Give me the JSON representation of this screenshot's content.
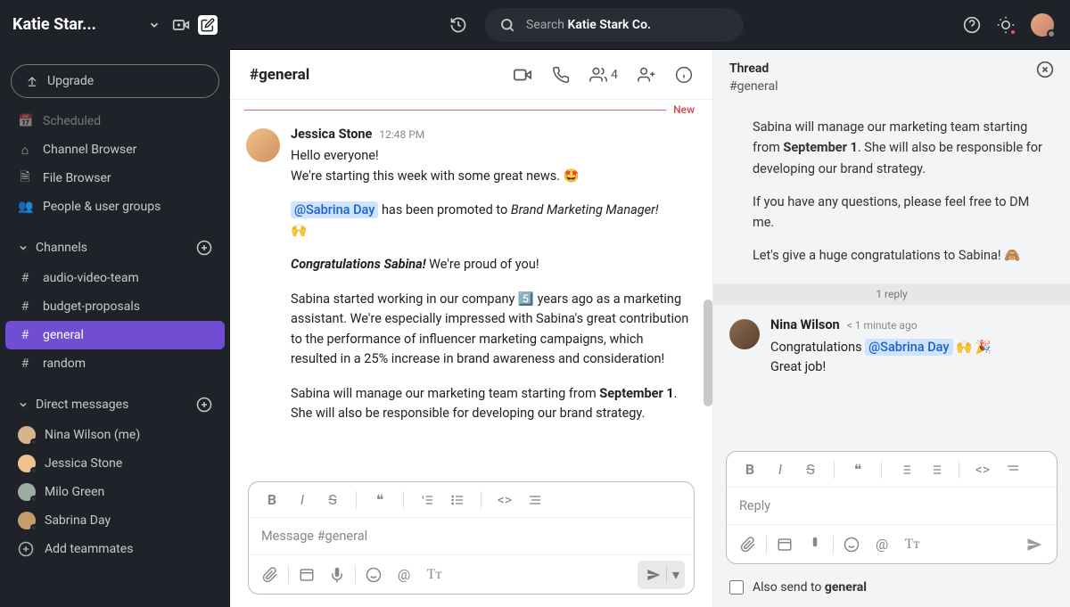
{
  "workspace": {
    "name": "Katie Star..."
  },
  "search": {
    "prefix": "Search",
    "scope": "Katie Stark Co."
  },
  "sidebar": {
    "upgrade": "Upgrade",
    "nav": [
      "Scheduled",
      "Channel Browser",
      "File Browser",
      "People & user groups"
    ],
    "channels_label": "Channels",
    "channels": [
      "audio-video-team",
      "budget-proposals",
      "general",
      "random"
    ],
    "dm_label": "Direct messages",
    "dms": [
      "Nina Wilson (me)",
      "Jessica Stone",
      "Milo Green",
      "Sabrina Day"
    ],
    "add_teammates": "Add teammates"
  },
  "channel": {
    "name": "#general",
    "member_count": "4",
    "new_label": "New",
    "composer_placeholder": "Message #general"
  },
  "message": {
    "author": "Jessica Stone",
    "time": "12:48 PM",
    "line1": "Hello everyone!",
    "line2": "We're starting this week with some great news. 🤩",
    "mention": "@Sabrina Day",
    "line3_after": " has been promoted to ",
    "role": "Brand Marketing Manager!",
    "hands": "🙌",
    "congrats": "Congratulations Sabina!",
    "congrats_after": " We're proud of you!",
    "para2": "Sabina started working in our company 5️⃣ years ago as a marketing assistant. We're especially impressed with Sabina's great contribution to the performance of influencer marketing campaigns, which resulted in a 25% increase in brand awareness and consideration!",
    "para3_a": "Sabina will manage our marketing team starting from ",
    "para3_date": "September 1",
    "para3_b": ". She will also be responsible for developing our brand strategy."
  },
  "thread": {
    "title": "Thread",
    "channel": "#general",
    "parent_a": "Sabina will manage our marketing team starting from ",
    "parent_date": "September 1",
    "parent_b": ". She will also be responsible for developing our brand strategy.",
    "parent_c": "If you have any questions, please feel free to DM me.",
    "parent_d": "Let's give a huge congratulations to Sabina! 🙈",
    "replies_label": "1 reply",
    "reply_author": "Nina Wilson",
    "reply_time": "< 1 minute ago",
    "reply_text_a": "Congratulations ",
    "reply_mention": "@Sabrina Day",
    "reply_emoji": " 🙌 🎉",
    "reply_text_b": "Great job!",
    "reply_placeholder": "Reply",
    "also_send_a": "Also send to ",
    "also_send_b": "general"
  }
}
